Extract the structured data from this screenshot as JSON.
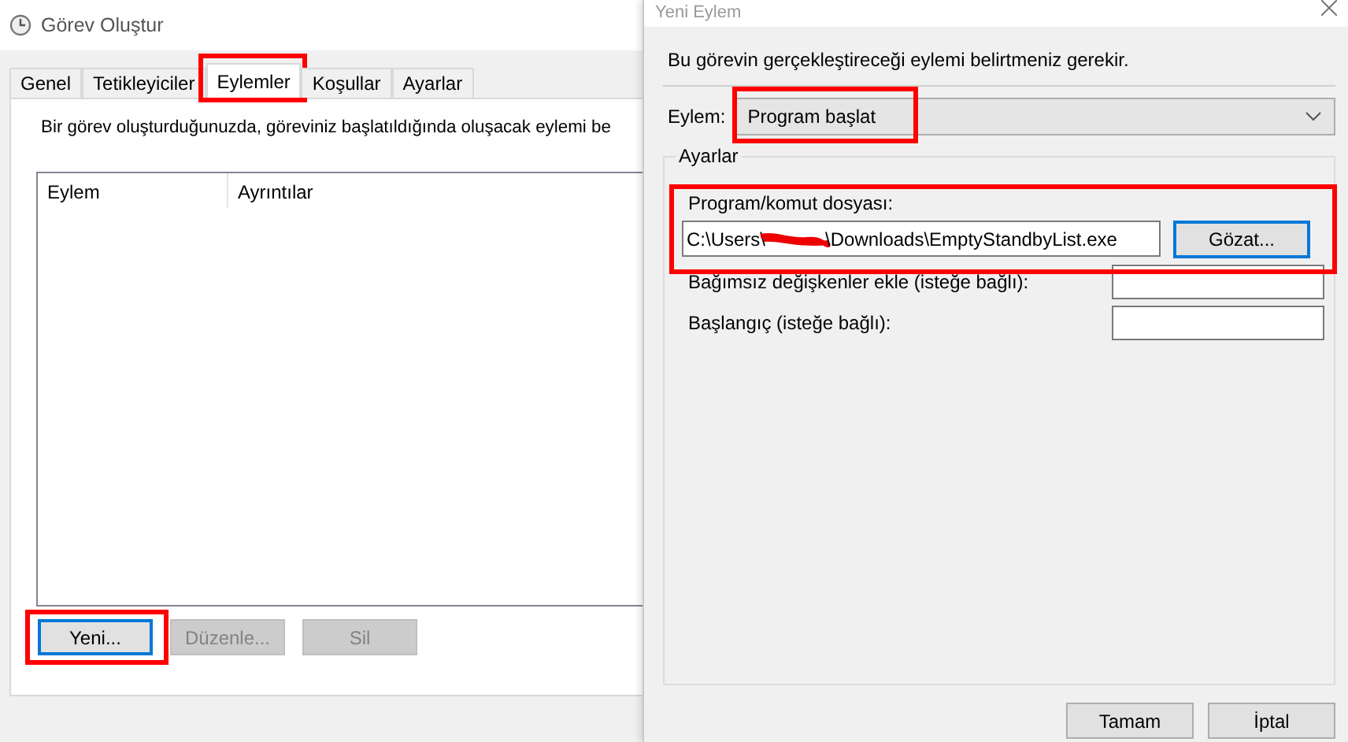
{
  "task_window": {
    "title": "Görev Oluştur",
    "tabs": [
      {
        "label": "Genel",
        "selected": false,
        "highlighted": false
      },
      {
        "label": "Tetikleyiciler",
        "selected": false,
        "highlighted": false
      },
      {
        "label": "Eylemler",
        "selected": true,
        "highlighted": true
      },
      {
        "label": "Koşullar",
        "selected": false,
        "highlighted": false
      },
      {
        "label": "Ayarlar",
        "selected": false,
        "highlighted": false
      }
    ],
    "description": "Bir görev oluşturduğunuzda, göreviniz başlatıldığında oluşacak eylemi be",
    "table": {
      "columns": [
        "Eylem",
        "Ayrıntılar"
      ]
    },
    "buttons": [
      {
        "label": "Yeni...",
        "disabled": false,
        "focused": true,
        "highlighted": true
      },
      {
        "label": "Düzenle...",
        "disabled": true,
        "focused": false,
        "highlighted": false
      },
      {
        "label": "Sil",
        "disabled": true,
        "focused": false,
        "highlighted": false
      }
    ]
  },
  "action_dialog": {
    "title": "Yeni Eylem",
    "instruction": "Bu görevin gerçekleştireceği eylemi belirtmeniz gerekir.",
    "action": {
      "label": "Eylem:",
      "value": "Program başlat",
      "highlighted": true
    },
    "settings": {
      "title": "Ayarlar",
      "program": {
        "label": "Program/komut dosyası:",
        "value_start": "C:\\Users\\",
        "redacted": true,
        "value_end": "\\Downloads\\EmptyStandbyList.exe",
        "button": "Gözat...",
        "highlighted": true
      },
      "fields": [
        {
          "label": "Bağımsız değişkenler ekle (isteğe bağlı):"
        },
        {
          "label": "Başlangıç (isteğe bağlı):"
        }
      ]
    },
    "buttons": [
      "Tamam",
      "İptal"
    ]
  }
}
